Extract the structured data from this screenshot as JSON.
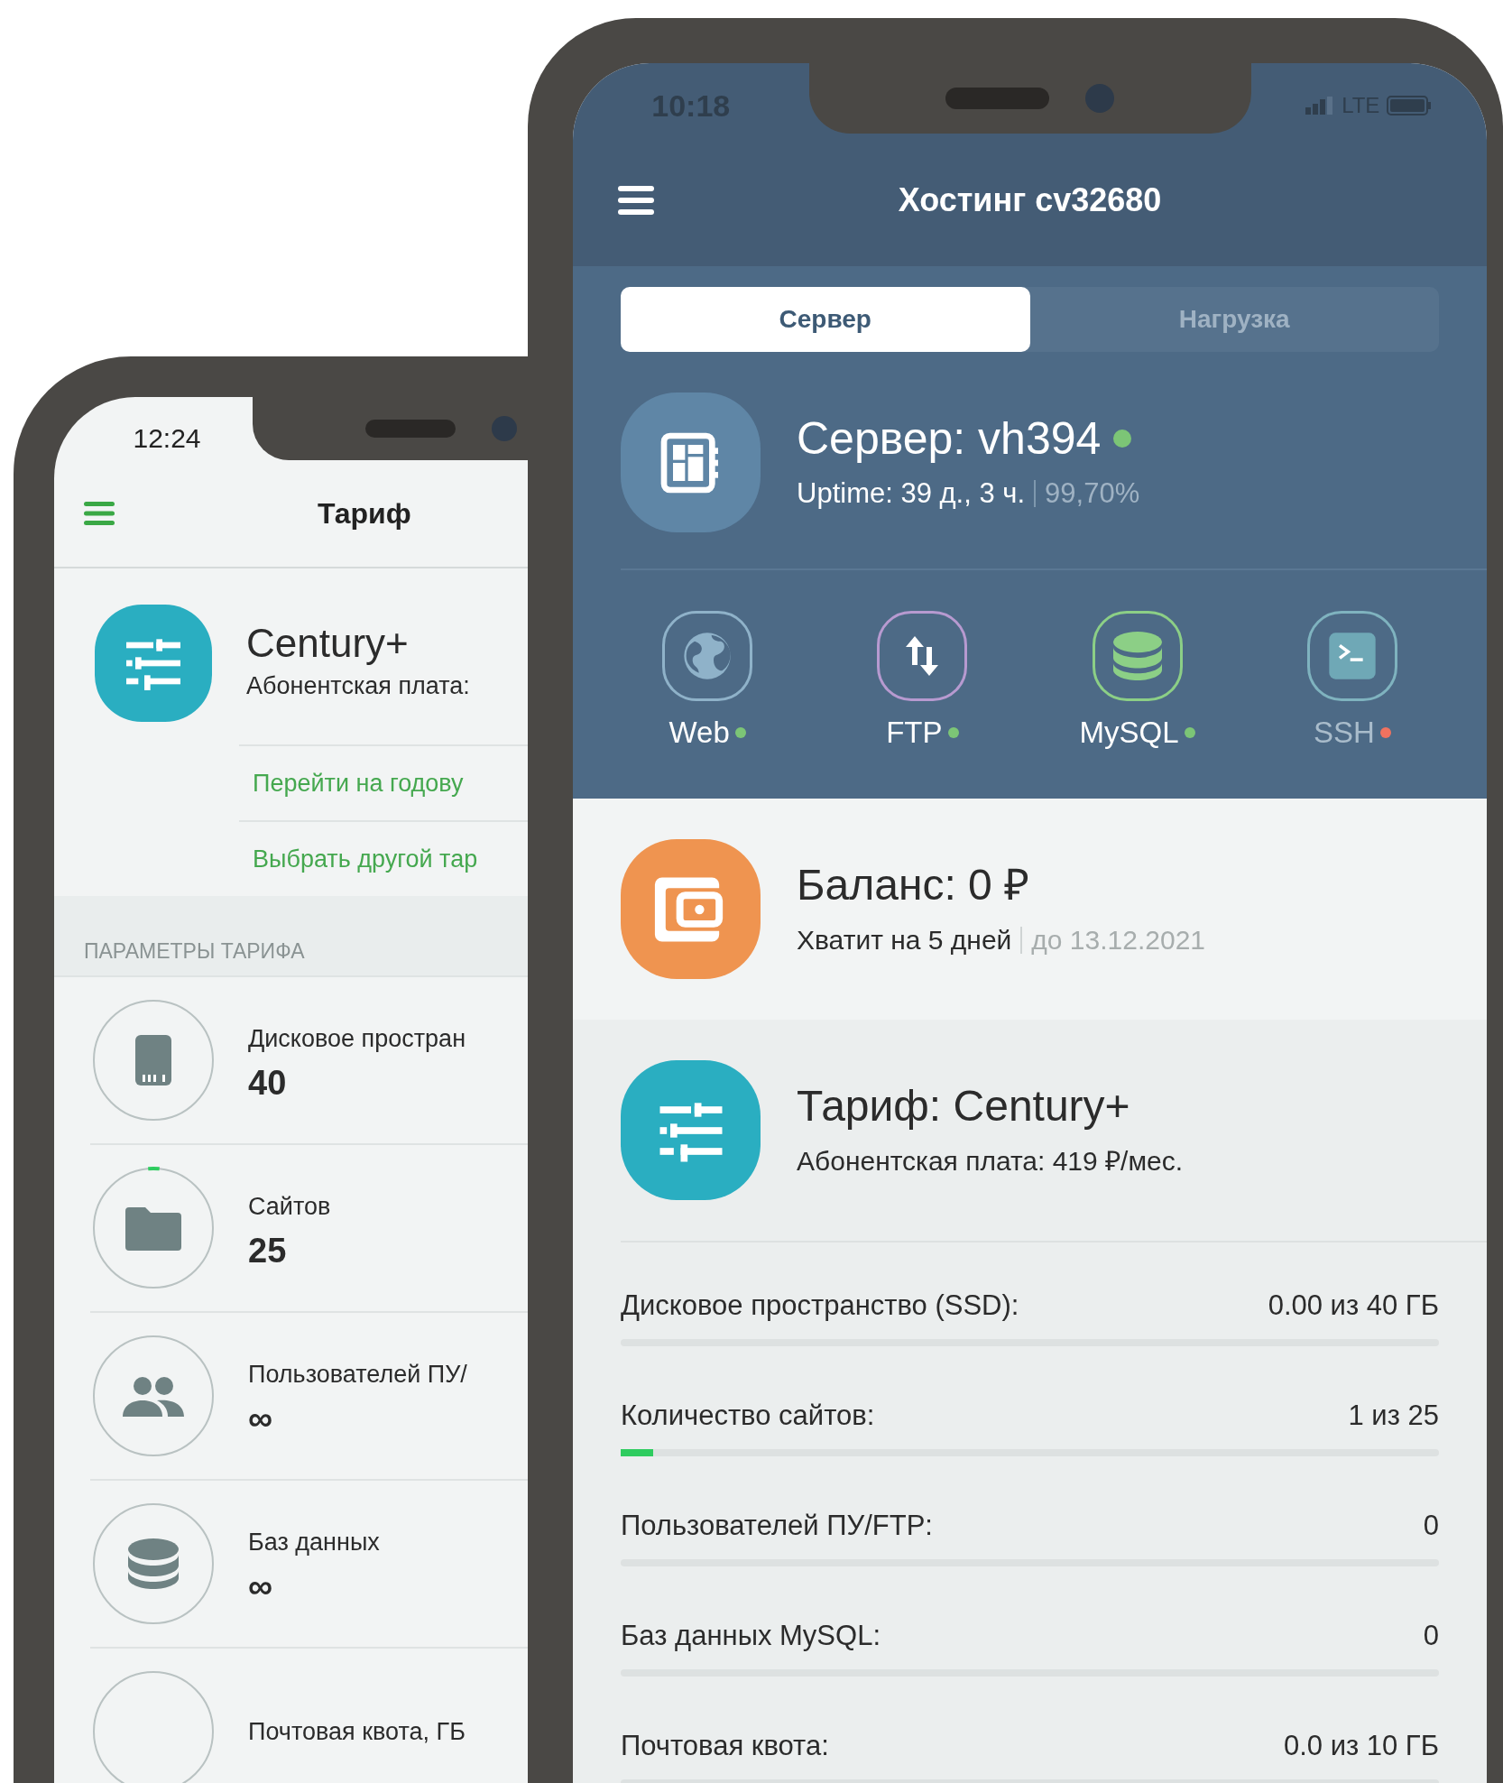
{
  "phones": [
    {
      "status_bar": {
        "time": "12:24"
      },
      "title": "Тариф",
      "plan": {
        "name": "Century+",
        "fee": "Абонентская плата:"
      },
      "links": [
        "Перейти на годову",
        "Выбрать другой тар"
      ],
      "section_header": "ПАРАМЕТРЫ ТАРИФА",
      "params": [
        {
          "kind": "disk",
          "label": "Дисковое простран",
          "value": "40"
        },
        {
          "kind": "sites",
          "label": "Сайтов",
          "value": "25",
          "level": 0.03
        },
        {
          "kind": "users",
          "label": "Пользователей ПУ/",
          "value": "∞"
        },
        {
          "kind": "databases",
          "label": "Баз данных",
          "value": "∞"
        },
        {
          "kind": "mail",
          "label": "Почтовая квота, ГБ"
        }
      ]
    },
    {
      "status_bar": {
        "time": "10:18",
        "network": "LTE"
      },
      "title": "Хостинг cv32680",
      "tabs": [
        {
          "label": "Сервер",
          "selected": true
        },
        {
          "label": "Нагрузка",
          "selected": false
        }
      ],
      "server": {
        "title": "Сервер: vh394",
        "online": true,
        "uptime": "Uptime: 39 д., 3 ч.",
        "availability": "99,70%"
      },
      "services": [
        {
          "kind": "web",
          "label": "Web",
          "color": "#7cc576"
        },
        {
          "kind": "ftp",
          "label": "FTP",
          "color": "#7cc576"
        },
        {
          "kind": "mysql",
          "label": "MySQL",
          "color": "#7cc576"
        },
        {
          "kind": "ssh",
          "label": "SSH",
          "color": "#f0725f"
        }
      ],
      "balance": {
        "title": "Баланс: 0 ₽",
        "forecast": "Хватит на 5 дней",
        "until": "до 13.12.2021"
      },
      "tariff": {
        "title": "Тариф: Century+",
        "fee": "Абонентская плата: 419 ₽/мес."
      },
      "usage": [
        {
          "label": "Дисковое пространство (SSD):",
          "value": "0.00 из 40 ГБ"
        },
        {
          "label": "Количество сайтов:",
          "value": "1 из 25",
          "level": 0.04
        },
        {
          "label": "Пользователей ПУ/FTP:",
          "value": "0"
        },
        {
          "label": "Баз данных MySQL:",
          "value": "0"
        },
        {
          "label": "Почтовая квота:",
          "value": "0.0 из 10 ГБ"
        }
      ]
    }
  ]
}
